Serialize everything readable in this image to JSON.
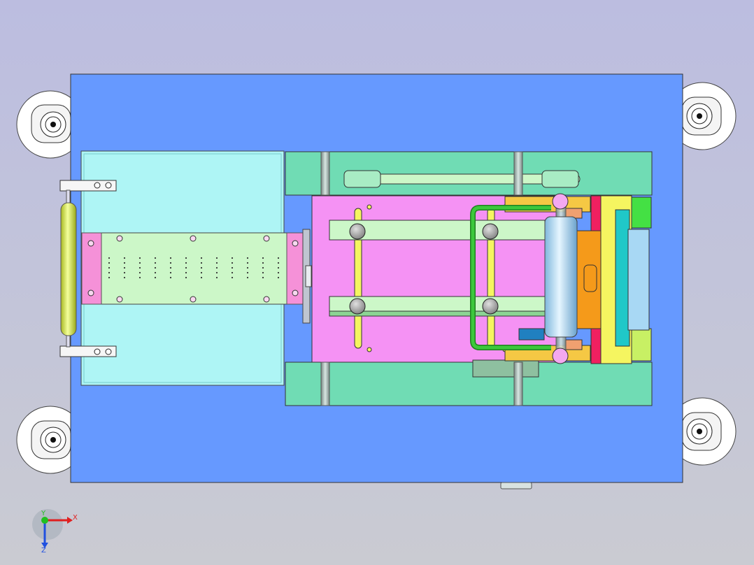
{
  "viewport": {
    "background_top": "#bcbde0",
    "background_bottom": "#cacbd2"
  },
  "model": {
    "base_plate_color": "#6699ff",
    "hopper_color": "#aef5f5",
    "perforated_plate_color": "#ccf7c8",
    "end_block_color": "#f591d8",
    "frame_rail_color": "#70dcb4",
    "carriage_color": "#f592f4",
    "roller_color": "#a8d8f4",
    "yellow_part_color": "#f5f560",
    "orange_part_color": "#f59a1a",
    "green_bracket_color": "#3cc83c",
    "wheel_color": "#ffffff"
  },
  "triad": {
    "x_label": "X",
    "y_label": "Y",
    "z_label": "Z",
    "x_color": "#e02020",
    "y_color": "#20c020",
    "z_color": "#2050e0"
  }
}
